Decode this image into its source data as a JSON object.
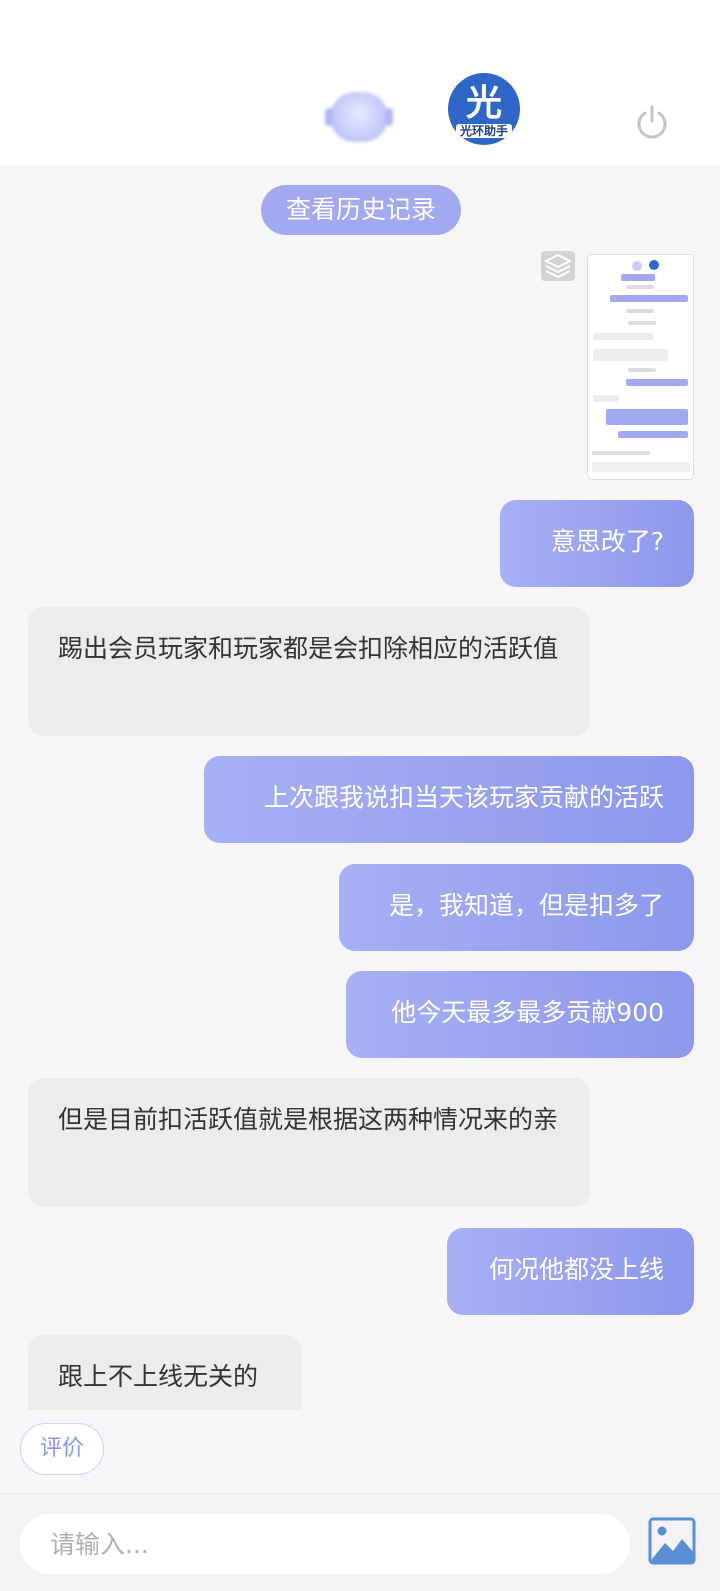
{
  "header": {
    "brand_glyph": "光",
    "brand_name": "光环助手",
    "avatar_icon": "headset-avatar-icon",
    "power_icon": "power-icon"
  },
  "history_button": "查看历史记录",
  "messages": [
    {
      "side": "out",
      "text": "意思改了?"
    },
    {
      "side": "in",
      "text": "踢出会员玩家和玩家都是会扣除相应的活跃值"
    },
    {
      "side": "out",
      "text": "上次跟我说扣当天该玩家贡献的活跃"
    },
    {
      "side": "out",
      "text": "是，我知道，但是扣多了"
    },
    {
      "side": "out",
      "text": "他今天最多最多贡献900"
    },
    {
      "side": "in",
      "text": "但是目前扣活跃值就是根据这两种情况来的亲"
    },
    {
      "side": "out",
      "text": "何况他都没上线"
    },
    {
      "side": "in",
      "text": "跟上不上线无关的"
    }
  ],
  "rate_button": "评价",
  "input": {
    "placeholder": "请输入...",
    "value": ""
  },
  "colors": {
    "accent": "#8d97ec",
    "accent_light": "#a7b0f4",
    "incoming_bubble": "#ececef",
    "brand_blue": "#2f67c8"
  }
}
